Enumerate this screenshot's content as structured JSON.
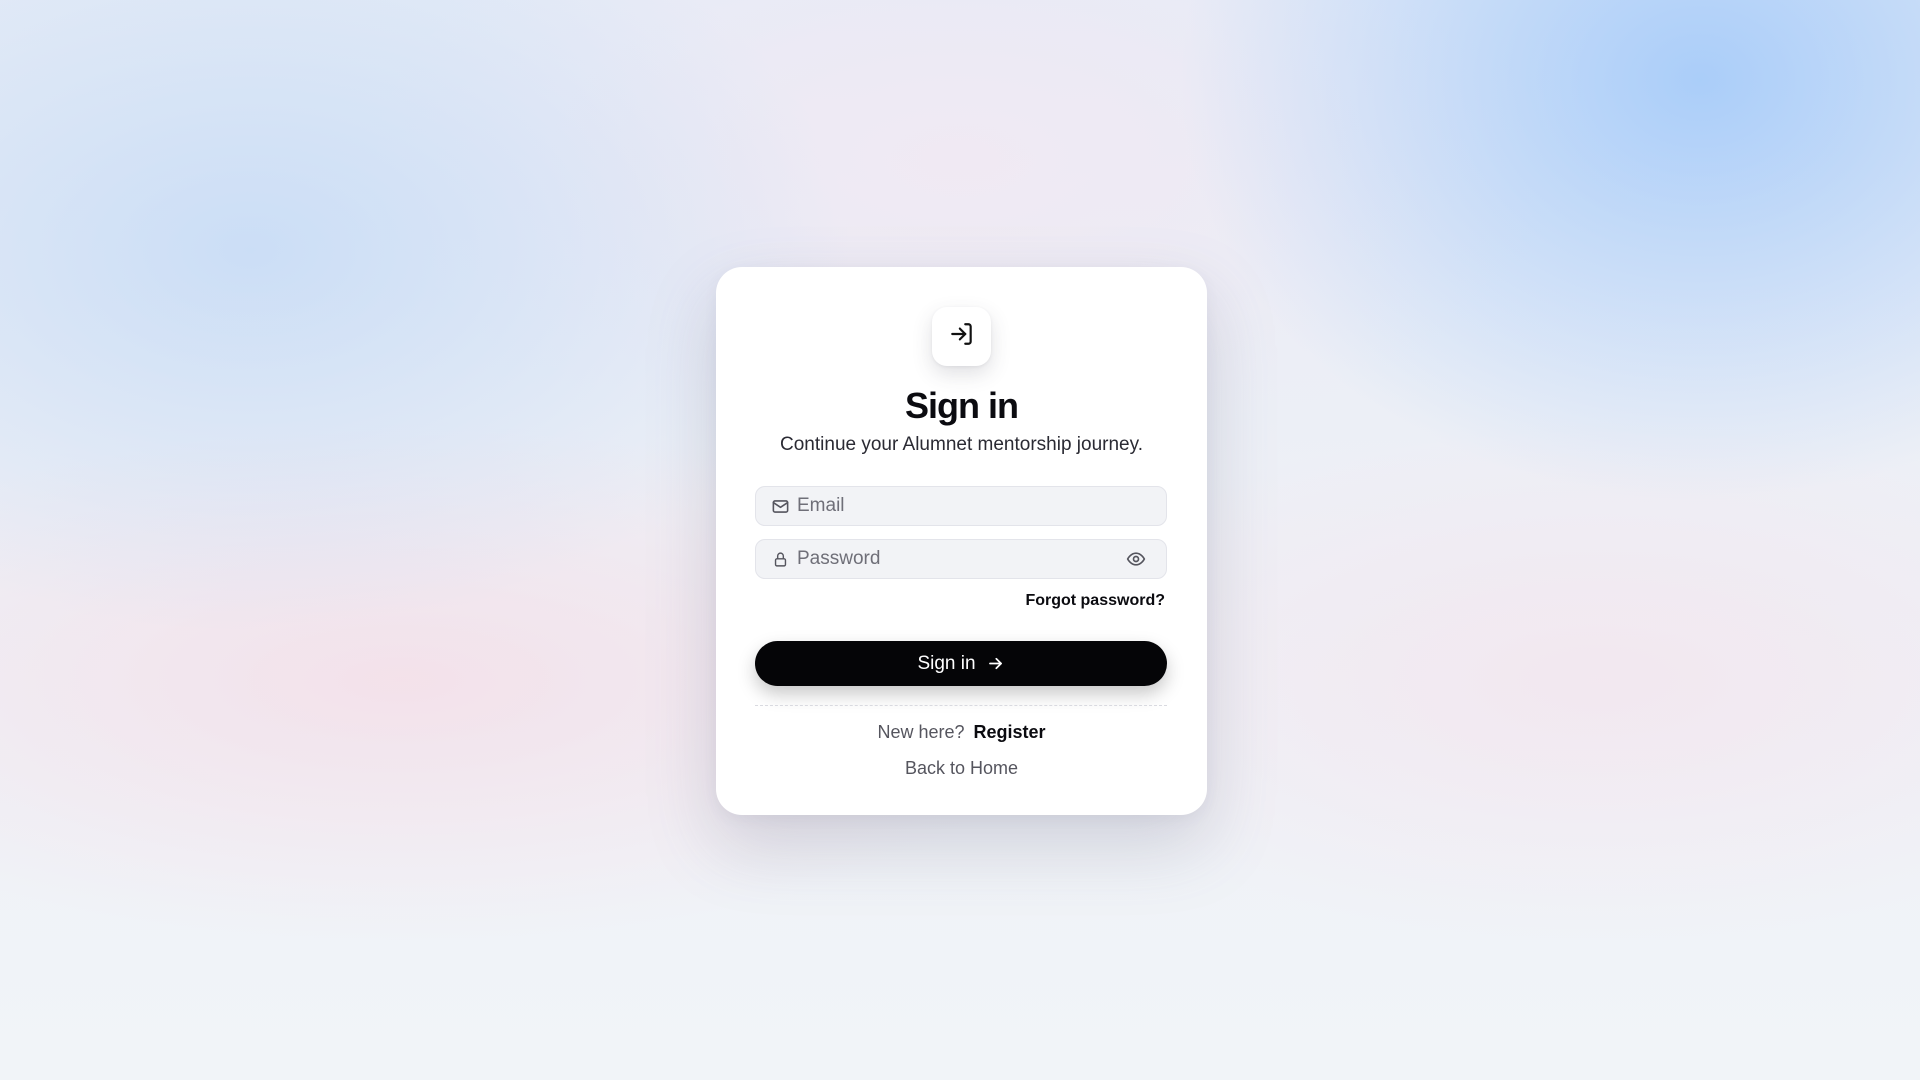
{
  "page": {
    "title": "Sign in",
    "subtitle": "Continue your Alumnet mentorship journey."
  },
  "logo": {
    "icon": "log-in-icon"
  },
  "form": {
    "email": {
      "icon": "mail-icon",
      "placeholder": "Email",
      "value": ""
    },
    "password": {
      "icon": "lock-icon",
      "placeholder": "Password",
      "value": "",
      "toggle_icon": "eye-icon"
    },
    "forgot_label": "Forgot password?",
    "submit_label": "Sign in",
    "submit_icon": "arrow-right-icon"
  },
  "footer": {
    "new_here": "New here?",
    "register_label": "Register",
    "back_home_label": "Back to Home"
  },
  "colors": {
    "button_bg": "#050507",
    "input_bg": "#f2f3f6",
    "card_bg": "#ffffff"
  }
}
